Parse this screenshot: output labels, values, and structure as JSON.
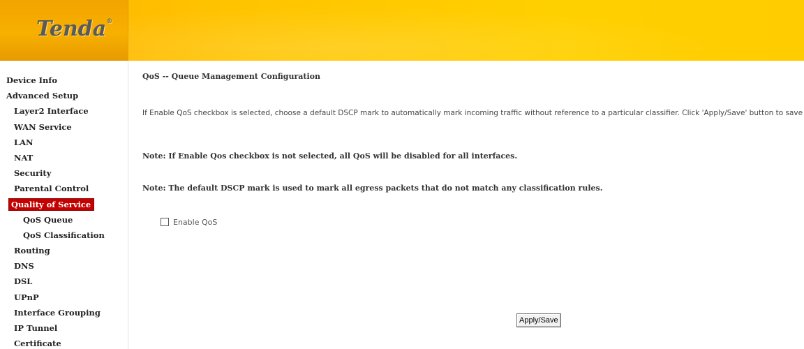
{
  "brand": {
    "logo_text": "Tenda",
    "logo_mark": "®"
  },
  "sidebar": {
    "items": [
      {
        "label": "Device Info",
        "level": 0
      },
      {
        "label": "Advanced Setup",
        "level": 0
      },
      {
        "label": "Layer2 Interface",
        "level": 1
      },
      {
        "label": "WAN Service",
        "level": 1
      },
      {
        "label": "LAN",
        "level": 1
      },
      {
        "label": "NAT",
        "level": 1
      },
      {
        "label": "Security",
        "level": 1
      },
      {
        "label": "Parental Control",
        "level": 1
      },
      {
        "label": "Quality of Service",
        "level": 1,
        "active": true
      },
      {
        "label": "QoS Queue",
        "level": 2
      },
      {
        "label": "QoS Classification",
        "level": 2
      },
      {
        "label": "Routing",
        "level": 1
      },
      {
        "label": "DNS",
        "level": 1
      },
      {
        "label": "DSL",
        "level": 1
      },
      {
        "label": "UPnP",
        "level": 1
      },
      {
        "label": "Interface Grouping",
        "level": 1
      },
      {
        "label": "IP Tunnel",
        "level": 1
      },
      {
        "label": "Certificate",
        "level": 1
      }
    ]
  },
  "main": {
    "title": "QoS -- Queue Management Configuration",
    "description": "If Enable QoS checkbox is selected, choose a default DSCP mark to automatically mark incoming traffic without reference to a particular classifier. Click 'Apply/Save' button to save it.",
    "note1": "Note: If Enable Qos checkbox is not selected, all QoS will be disabled for all interfaces.",
    "note2": "Note: The default DSCP mark is used to mark all egress packets that do not match any classification rules.",
    "enable_qos_label": "Enable QoS",
    "enable_qos_checked": false,
    "apply_label": "Apply/Save"
  },
  "colors": {
    "header": "#ffc800",
    "active_item": "#c40000"
  }
}
